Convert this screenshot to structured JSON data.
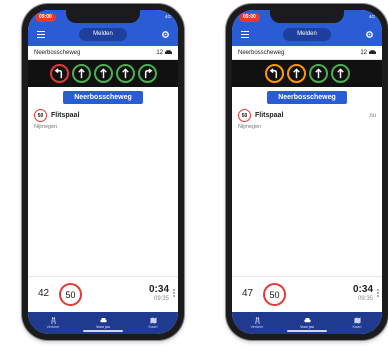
{
  "phones": [
    {
      "status": {
        "time": "09:00",
        "indicators": "4G"
      },
      "appbar": {
        "melden_label": "Melden"
      },
      "street": {
        "name": "Neerbosscheweg",
        "count": "12"
      },
      "lanes": [
        {
          "icon": "turn-left-icon",
          "color": "red"
        },
        {
          "icon": "straight-icon",
          "color": "green"
        },
        {
          "icon": "straight-icon",
          "color": "green"
        },
        {
          "icon": "straight-icon",
          "color": "green"
        },
        {
          "icon": "turn-right-icon",
          "color": "green"
        }
      ],
      "current_street": "Neerbosscheweg",
      "alert": {
        "sign": "50",
        "title": "Flitspaal",
        "city": "Nijmegen",
        "time_label": ""
      },
      "bottom": {
        "speed": "42",
        "limit": "50",
        "duration": "0:34",
        "arrival": "09:35"
      },
      "tabs": [
        {
          "label": "Verkeer"
        },
        {
          "label": "Voor jou"
        },
        {
          "label": "Kaart"
        }
      ]
    },
    {
      "status": {
        "time": "09:00",
        "indicators": "4G"
      },
      "appbar": {
        "melden_label": "Melden"
      },
      "street": {
        "name": "Neerbosscheweg",
        "count": "12"
      },
      "lanes": [
        {
          "icon": "turn-left-icon",
          "color": "orange"
        },
        {
          "icon": "straight-icon",
          "color": "orange"
        },
        {
          "icon": "straight-icon",
          "color": "green"
        },
        {
          "icon": "straight-icon",
          "color": "green"
        }
      ],
      "current_street": "Neerbosscheweg",
      "alert": {
        "sign": "50",
        "title": "Flitspaal",
        "city": "Nijmegen",
        "time_label": "nu"
      },
      "bottom": {
        "speed": "47",
        "limit": "50",
        "duration": "0:34",
        "arrival": "09:35"
      },
      "tabs": [
        {
          "label": "Verkeer"
        },
        {
          "label": "Voor jou"
        },
        {
          "label": "Kaart"
        }
      ]
    }
  ],
  "colors": {
    "primary": "#2a5cd6",
    "tabbar": "#1f3a8f",
    "limit_red": "#e53935",
    "lane_green": "#4caf50",
    "lane_orange": "#ff9800"
  }
}
